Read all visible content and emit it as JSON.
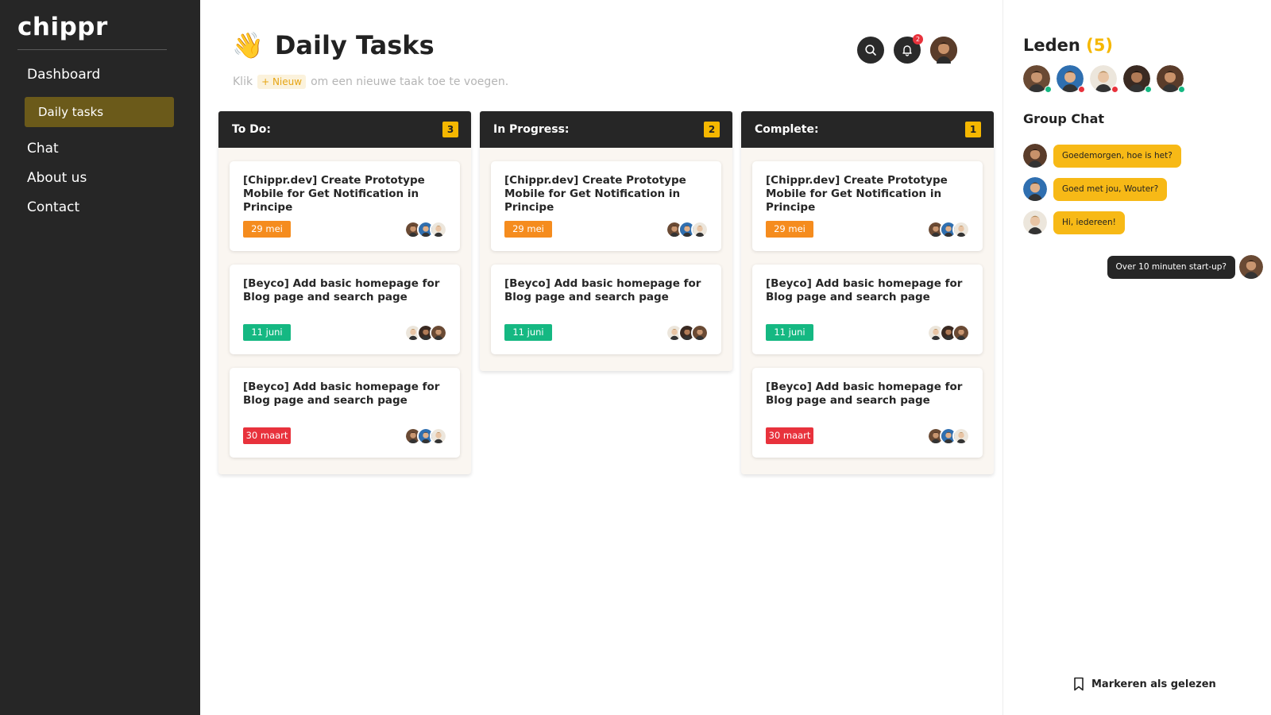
{
  "sidebar": {
    "logo": "chippr",
    "nav": [
      {
        "label": "Dashboard"
      },
      {
        "label": "Daily tasks"
      },
      {
        "label": "Chat"
      },
      {
        "label": "About us"
      },
      {
        "label": "Contact"
      }
    ]
  },
  "header": {
    "emoji": "👋",
    "title": "Daily Tasks",
    "hint_before": "Klik",
    "hint_chip": "+ Nieuw",
    "hint_after": "om een nieuwe taak toe te voegen.",
    "notification_count": "2"
  },
  "columns": [
    {
      "title": "To Do:",
      "count": "3",
      "cards": [
        {
          "title": "[Chippr.dev] Create Prototype Mobile for Get Notification in Principe",
          "due": "29 mei",
          "due_color": "#f58c1e"
        },
        {
          "title": "[Beyco] Add basic homepage for Blog page and search page",
          "due": "11 juni",
          "due_color": "#15b882"
        },
        {
          "title": "[Beyco] Add basic homepage for Blog page and search page",
          "due": "30 maart",
          "due_color": "#e8323c"
        }
      ]
    },
    {
      "title": "In Progress:",
      "count": "2",
      "cards": [
        {
          "title": "[Chippr.dev] Create Prototype Mobile for Get Notification in Principe",
          "due": "29 mei",
          "due_color": "#f58c1e"
        },
        {
          "title": "[Beyco] Add basic homepage for Blog page and search page",
          "due": "11 juni",
          "due_color": "#15b882"
        }
      ]
    },
    {
      "title": "Complete:",
      "count": "1",
      "cards": [
        {
          "title": "[Chippr.dev] Create Prototype Mobile for Get Notification in Principe",
          "due": "29 mei",
          "due_color": "#f58c1e"
        },
        {
          "title": "[Beyco] Add basic homepage for Blog page and search page",
          "due": "11 juni",
          "due_color": "#15b882"
        },
        {
          "title": "[Beyco] Add basic homepage for Blog page and search page",
          "due": "30 maart",
          "due_color": "#e8323c"
        }
      ]
    }
  ],
  "members": {
    "title": "Leden",
    "count": "(5)",
    "status_colors": [
      "#15b882",
      "#e8323c",
      "#e8323c",
      "#15b882",
      "#15b882"
    ]
  },
  "chat": {
    "title": "Group Chat",
    "messages": [
      {
        "text": "Goedemorgen, hoe is het?",
        "direction": "in"
      },
      {
        "text": "Goed met jou, Wouter?",
        "direction": "in"
      },
      {
        "text": "Hi, iedereen!",
        "direction": "in"
      },
      {
        "text": "Over 10 minuten start-up?",
        "direction": "out"
      }
    ],
    "mark_read": "Markeren als gelezen"
  },
  "colors": {
    "accent": "#f5b700",
    "dark": "#262626",
    "active_nav": "#6b5a1a"
  }
}
